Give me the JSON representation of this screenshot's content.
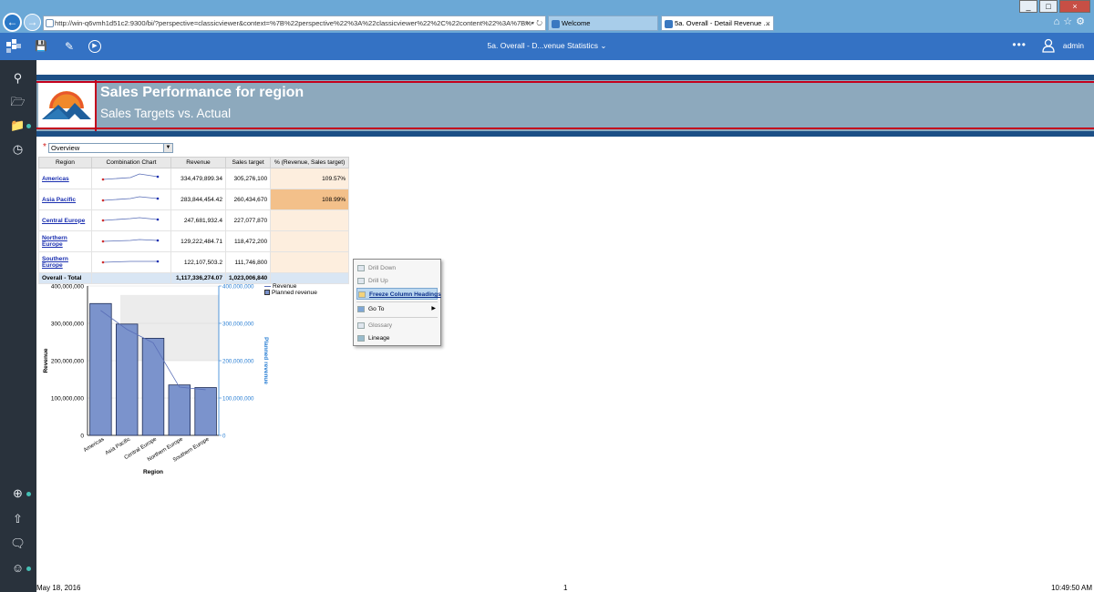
{
  "browser": {
    "url": "http://win-q6vmh1d51c2:9300/bi/?perspective=classicviewer&context=%7B%22perspective%22%3A%22classicviewer%22%2C%22content%22%3A%7B%",
    "addr_tools": "⌕ ▾ ↻",
    "tabs": [
      {
        "label": "Welcome"
      },
      {
        "label": "5a. Overall - Detail Revenue ...",
        "close": "×"
      }
    ],
    "window_controls": [
      "_",
      "□",
      "×"
    ],
    "tools": "⌂☆⚙"
  },
  "app_bar": {
    "title": "5a. Overall - D...venue Statistics ⌄",
    "more": "•••",
    "user": "admin"
  },
  "banner": {
    "title": "Sales Performance for region",
    "subtitle": "Sales Targets vs. Actual"
  },
  "prompt": {
    "required_mark": "*",
    "value": "Overview"
  },
  "crosstab": {
    "headers": [
      "Region",
      "Combination Chart",
      "Revenue",
      "Sales target",
      "% (Revenue, Sales target)"
    ],
    "rows": [
      {
        "region": "Americas",
        "revenue": "334,479,899.34",
        "target": "305,276,100",
        "pct": "109.57%"
      },
      {
        "region": "Asia Pacific",
        "revenue": "283,844,454.42",
        "target": "260,434,670",
        "pct": "108.99%"
      },
      {
        "region": "Central Europe",
        "revenue": "247,681,932.4",
        "target": "227,077,870",
        "pct": ""
      },
      {
        "region": "Northern Europe",
        "revenue": "129,222,484.71",
        "target": "118,472,200",
        "pct": ""
      },
      {
        "region": "Southern Europe",
        "revenue": "122,107,503.2",
        "target": "111,746,800",
        "pct": ""
      }
    ],
    "total": {
      "label": "Overall - Total",
      "revenue": "1,117,336,274.07",
      "target": "1,023,006,840"
    }
  },
  "context_menu": {
    "items": [
      "Drill Down",
      "Drill Up",
      "Freeze Column Headings",
      "Go To",
      "Glossary",
      "Lineage"
    ],
    "goto_arrow": "▶"
  },
  "chart_data": {
    "type": "bar",
    "categories": [
      "Americas",
      "Asia Pacific",
      "Central Europe",
      "Northern Europe",
      "Southern Europe"
    ],
    "series": [
      {
        "name": "Planned revenue",
        "values": [
          353000000,
          298000000,
          260000000,
          135000000,
          128000000
        ]
      },
      {
        "name": "Revenue",
        "values": [
          334479899,
          283844454,
          247681932,
          129222485,
          122107503
        ]
      }
    ],
    "xlabel": "Region",
    "ylabel": "Revenue",
    "y2label": "Planned revenue",
    "ylim": [
      0,
      400000000
    ],
    "yticks": [
      "400,000,000",
      "300,000,000",
      "200,000,000",
      "100,000,000",
      "0"
    ],
    "colors": {
      "bar": "#7b93cc",
      "line": "#5a6fb8",
      "axis2": "#2a7fd4"
    }
  },
  "footer": {
    "date": "May 18, 2016",
    "page": "1",
    "time": "10:49:50 AM"
  }
}
